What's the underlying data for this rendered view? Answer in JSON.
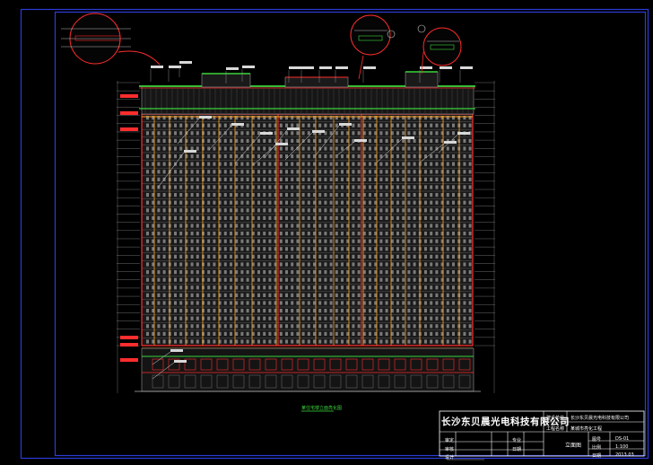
{
  "company_name": "长沙东贝晨光电科技有限公司",
  "title_block": {
    "owner_label": "建设单位",
    "owner_value": "长沙东贝晨光电科技有限公司",
    "project_label": "工程名称",
    "project_value": "某城市亮化工程",
    "drawing_name": "立面图",
    "sign_rows": [
      "审定",
      "审核",
      "设计"
    ],
    "sign_cols": [
      "专业",
      "日期"
    ],
    "right_labels": [
      "图号",
      "比例",
      "日期"
    ],
    "right_values": [
      "DS-01",
      "1:100",
      "2013.03"
    ]
  },
  "drawing_caption": "某住宅楼立面亮化图",
  "colors": {
    "frame": "#2c3bd6",
    "building_line": "#b0b0b0",
    "light_red": "#ff2d2d",
    "light_orange": "#ffa21f",
    "light_green": "#3bd43b",
    "label_white": "#e8e8e8"
  }
}
